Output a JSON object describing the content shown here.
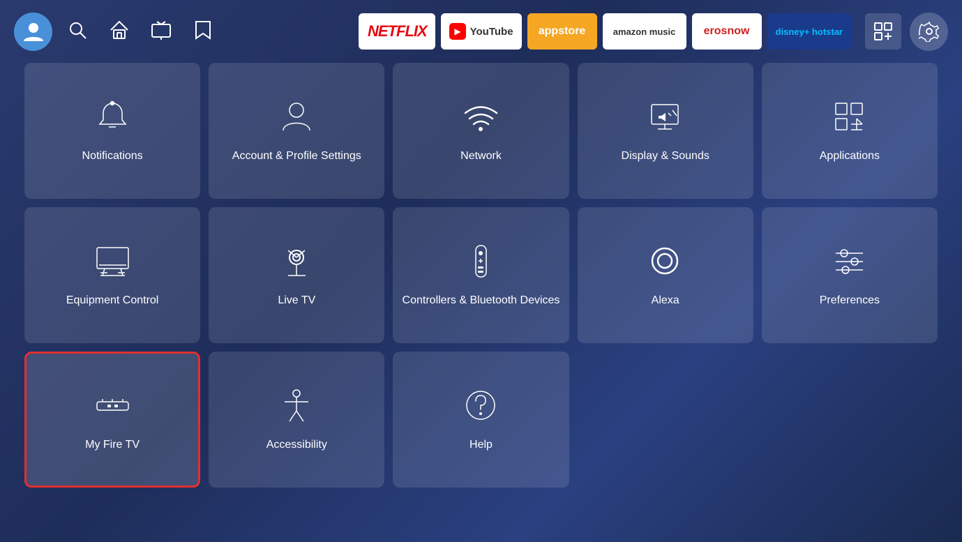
{
  "topbar": {
    "nav_items": [
      "search",
      "home",
      "live-tv",
      "bookmark"
    ],
    "apps": [
      {
        "id": "netflix",
        "label": "NETFLIX",
        "class": "netflix"
      },
      {
        "id": "youtube",
        "label": "YouTube",
        "class": "youtube"
      },
      {
        "id": "appstore",
        "label": "appstore",
        "class": "appstore"
      },
      {
        "id": "amazon-music",
        "label": "amazon music",
        "class": "amazon-music"
      },
      {
        "id": "erosnow",
        "label": "erosnow",
        "class": "erosnow"
      },
      {
        "id": "hotstar",
        "label": "disney+ hotstar",
        "class": "hotstar"
      }
    ]
  },
  "tiles": [
    {
      "id": "notifications",
      "label": "Notifications",
      "icon": "bell"
    },
    {
      "id": "account-profile",
      "label": "Account & Profile Settings",
      "icon": "person"
    },
    {
      "id": "network",
      "label": "Network",
      "icon": "wifi"
    },
    {
      "id": "display-sounds",
      "label": "Display & Sounds",
      "icon": "monitor-sound"
    },
    {
      "id": "applications",
      "label": "Applications",
      "icon": "apps"
    },
    {
      "id": "equipment-control",
      "label": "Equipment Control",
      "icon": "monitor"
    },
    {
      "id": "live-tv",
      "label": "Live TV",
      "icon": "antenna"
    },
    {
      "id": "controllers-bluetooth",
      "label": "Controllers & Bluetooth Devices",
      "icon": "remote"
    },
    {
      "id": "alexa",
      "label": "Alexa",
      "icon": "alexa"
    },
    {
      "id": "preferences",
      "label": "Preferences",
      "icon": "sliders"
    },
    {
      "id": "my-fire-tv",
      "label": "My Fire TV",
      "icon": "fire-tv",
      "selected": true
    },
    {
      "id": "accessibility",
      "label": "Accessibility",
      "icon": "accessibility"
    },
    {
      "id": "help",
      "label": "Help",
      "icon": "help"
    }
  ]
}
